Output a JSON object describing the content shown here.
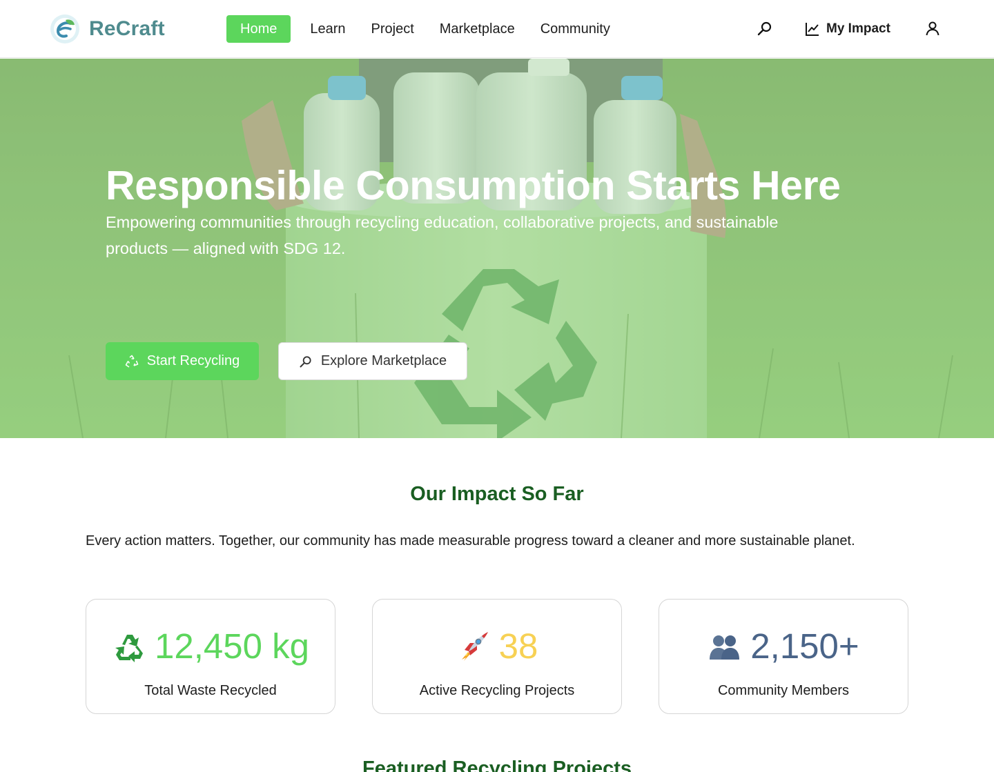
{
  "brand": {
    "name": "ReCraft",
    "logo_icon": "leaf-e-logo-icon",
    "accent": "#5cd65c",
    "logo_color": "#4f8b8e"
  },
  "nav": {
    "items": [
      {
        "label": "Home",
        "active": true
      },
      {
        "label": "Learn",
        "active": false
      },
      {
        "label": "Project",
        "active": false
      },
      {
        "label": "Marketplace",
        "active": false
      },
      {
        "label": "Community",
        "active": false
      }
    ],
    "search_icon": "search-icon",
    "impact_label": "My Impact",
    "impact_icon": "line-chart-icon",
    "user_icon": "user-icon"
  },
  "hero": {
    "title": "Responsible Consumption Starts Here",
    "subtitle_line1": "Empowering communities through recycling education, collaborative projects, and sustainable",
    "subtitle_line2": "products — aligned with SDG 12.",
    "primary_button": {
      "label": "Start Recycling",
      "icon": "recycle-icon"
    },
    "secondary_button": {
      "label": "Explore Marketplace",
      "icon": "search-icon"
    },
    "overlay_color": "#8fce83"
  },
  "impact": {
    "title": "Our Impact So Far",
    "description": "Every action matters. Together, our community has made measurable progress toward a cleaner and more sustainable planet.",
    "stats": [
      {
        "value": "12,450 kg",
        "label": "Total Waste Recycled",
        "icon": "recycle-symbol-icon",
        "color": "#5cd65c"
      },
      {
        "value": "38",
        "label": "Active Recycling Projects",
        "icon": "rocket-icon",
        "color": "#f7d154"
      },
      {
        "value": "2,150+",
        "label": "Community Members",
        "icon": "people-icon",
        "color": "#4a6488"
      }
    ]
  },
  "featured": {
    "title": "Featured Recycling Projects"
  }
}
